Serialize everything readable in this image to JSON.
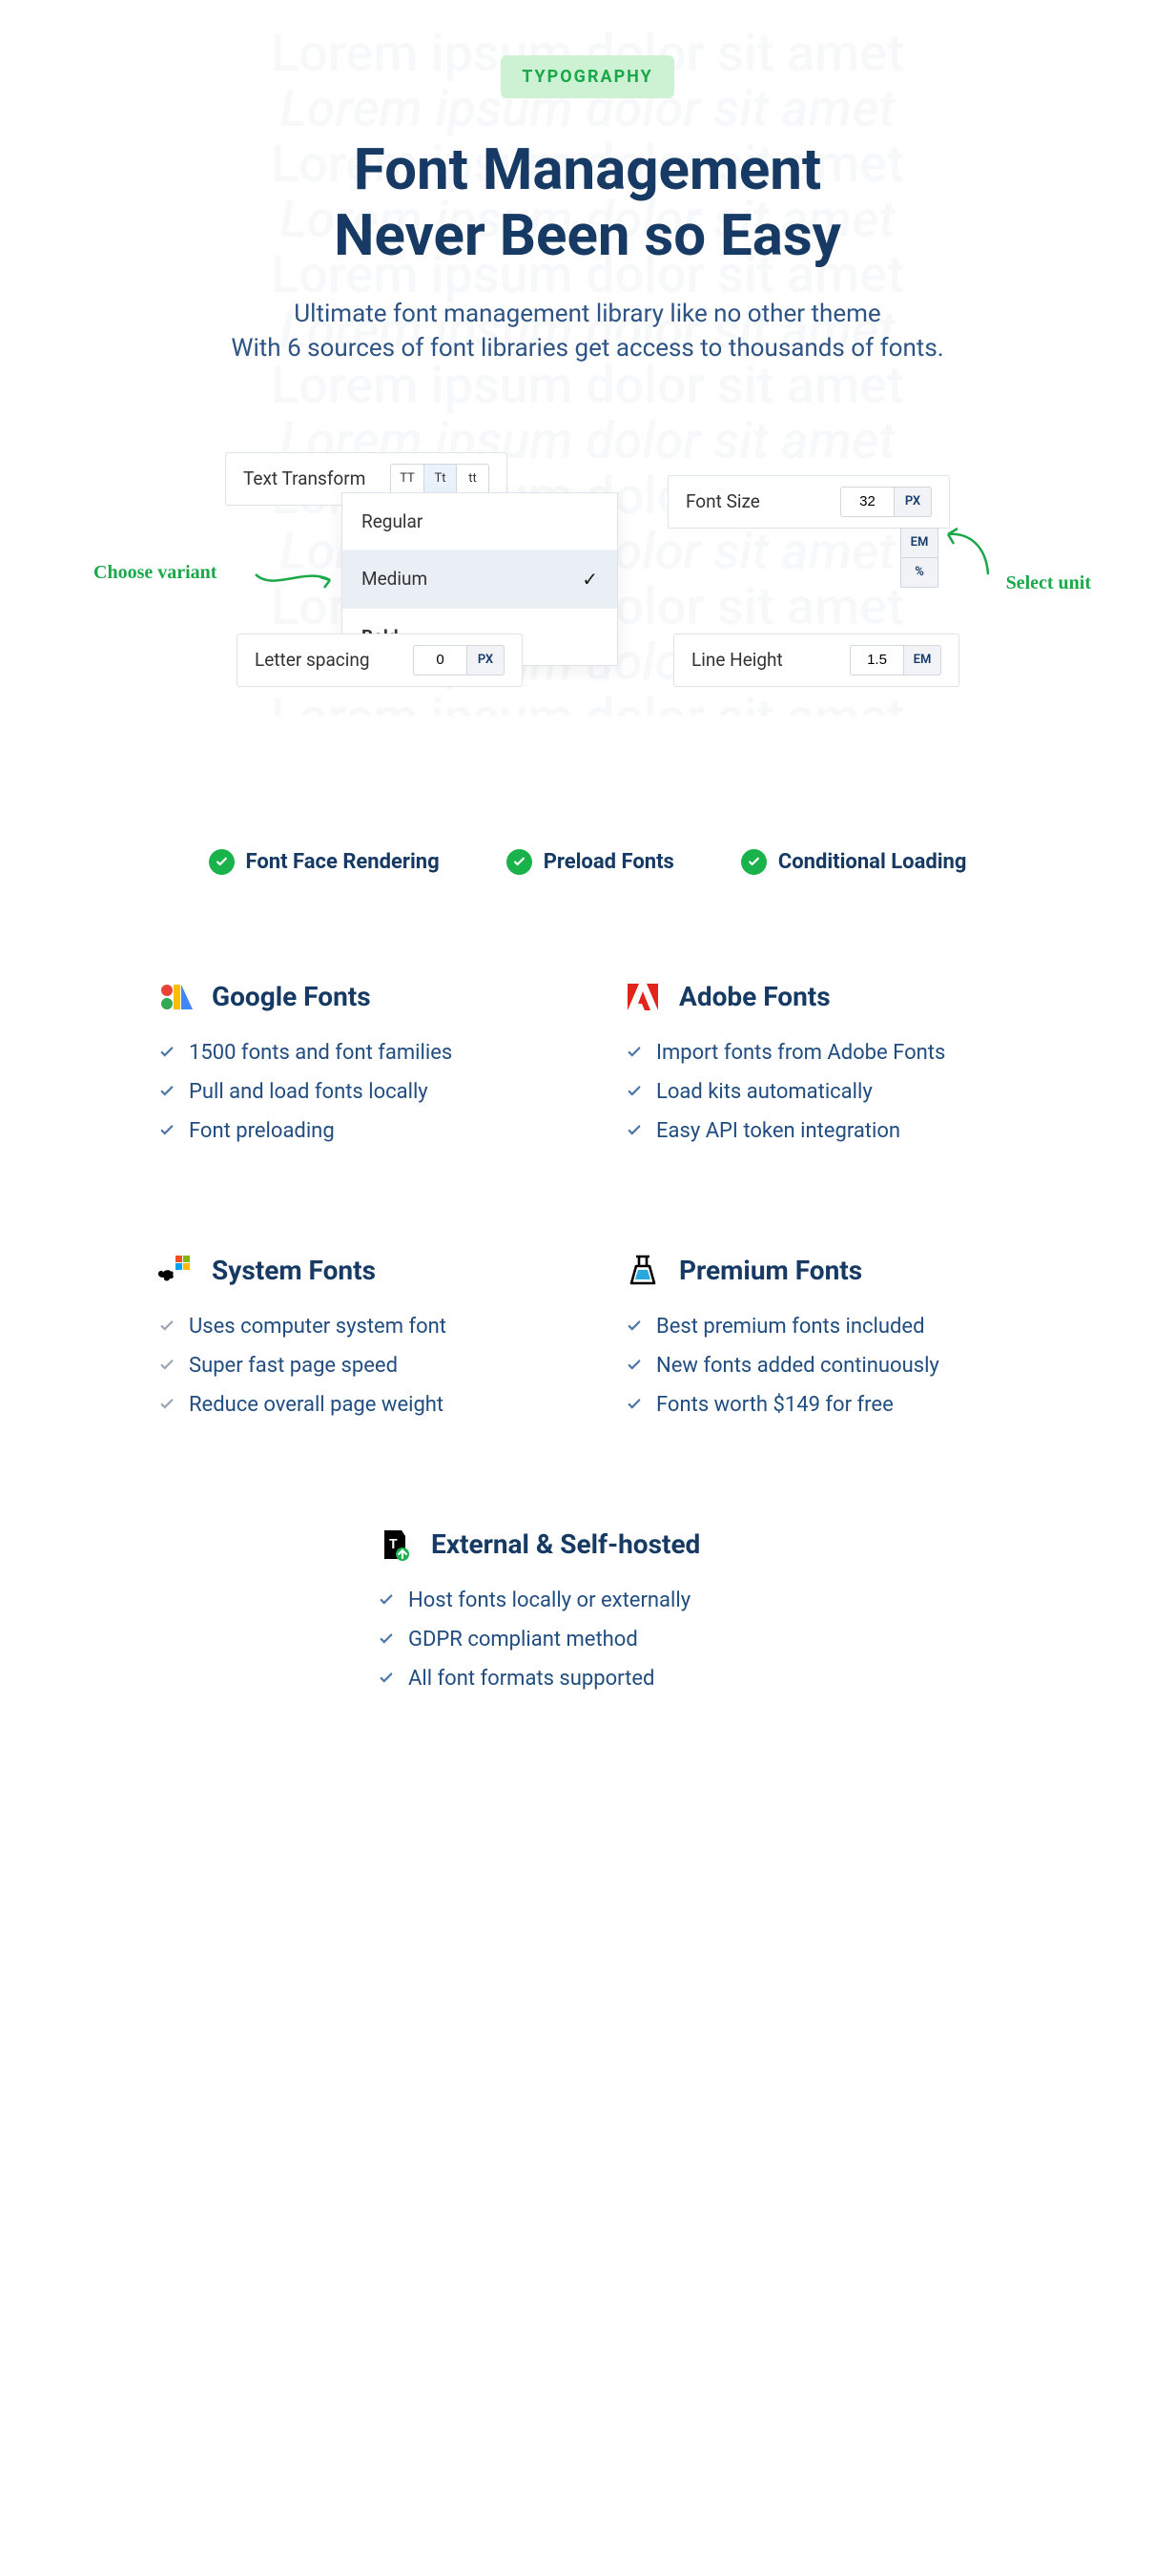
{
  "bg_text": "Lorem ipsum dolor sit amet",
  "header": {
    "badge": "TYPOGRAPHY",
    "title_line1": "Font Management",
    "title_line2": "Never Been so Easy",
    "subtitle_line1": "Ultimate font management library like no other theme",
    "subtitle_line2": "With 6 sources of font libraries get access to thousands of fonts."
  },
  "demo": {
    "text_transform": {
      "label": "Text Transform",
      "options": [
        "TT",
        "Tt",
        "tt"
      ],
      "active_index": 1
    },
    "font_size": {
      "label": "Font Size",
      "value": "32",
      "unit": "PX",
      "unit_options": [
        "EM",
        "%"
      ]
    },
    "letter_spacing": {
      "label": "Letter spacing",
      "value": "0",
      "unit": "PX"
    },
    "line_height": {
      "label": "Line Height",
      "value": "1.5",
      "unit": "EM"
    },
    "variants": [
      "Regular",
      "Medium",
      "Bold"
    ],
    "variant_selected_index": 1,
    "annotations": {
      "choose_variant": "Choose variant",
      "select_unit": "Select unit"
    }
  },
  "features": [
    "Font Face Rendering",
    "Preload Fonts",
    "Conditional Loading"
  ],
  "sources": {
    "google": {
      "title": "Google Fonts",
      "items": [
        "1500 fonts and font families",
        "Pull and load  fonts locally",
        "Font preloading"
      ]
    },
    "adobe": {
      "title": "Adobe Fonts",
      "items": [
        "Import fonts from Adobe Fonts",
        "Load kits automatically",
        "Easy API token integration"
      ]
    },
    "system": {
      "title": "System Fonts",
      "items": [
        "Uses computer system font",
        "Super fast page speed",
        "Reduce overall page weight"
      ]
    },
    "premium": {
      "title": "Premium Fonts",
      "items": [
        "Best premium fonts included",
        "New fonts added continuously",
        "Fonts worth $149 for free"
      ]
    },
    "external": {
      "title": "External & Self-hosted",
      "items": [
        "Host fonts locally or externally",
        "GDPR compliant method",
        "All font formats supported"
      ]
    }
  }
}
